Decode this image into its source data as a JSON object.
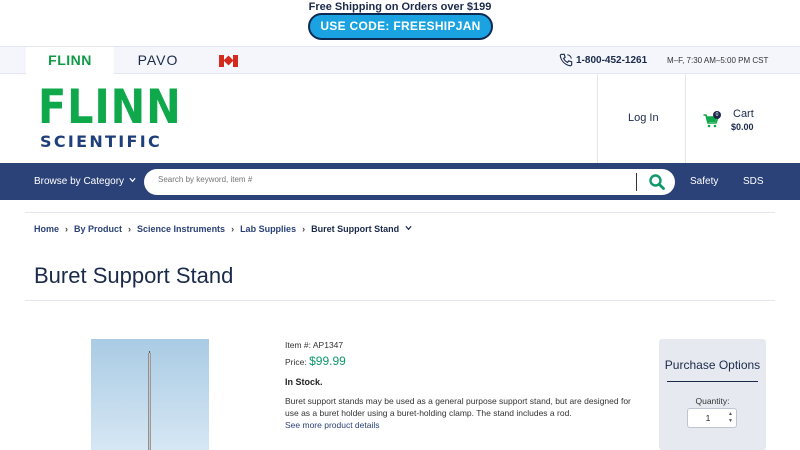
{
  "promo": {
    "text": "Free Shipping on Orders over $199",
    "code": "USE CODE: FREESHIPJAN"
  },
  "brand_tabs": {
    "flinn": "FLINN",
    "pavo": "PAVO",
    "canada_flag": "canada-flag-icon"
  },
  "contact": {
    "phone": "1-800-452-1261",
    "hours": "M–F, 7:30 AM–5:00 PM CST"
  },
  "logo": {
    "line1": "FLINN",
    "line2": "SCIENTIFIC"
  },
  "account": {
    "login": "Log In",
    "cart_label": "Cart",
    "cart_total": "$0.00",
    "cart_count": "0"
  },
  "nav": {
    "browse": "Browse by Category",
    "search_placeholder": "Search by keyword, item #",
    "safety": "Safety",
    "sds": "SDS"
  },
  "breadcrumb": {
    "items": [
      "Home",
      "By Product",
      "Science Instruments",
      "Lab Supplies"
    ],
    "current": "Buret Support Stand"
  },
  "product": {
    "title": "Buret Support Stand",
    "item_number": "Item #: AP1347",
    "price_label": "Price:",
    "price": "$99.99",
    "stock": "In Stock.",
    "description": "Buret support stands may be used as a general purpose support stand, but are designed for use as a buret holder using a buret-holding clamp. The stand includes a rod.",
    "more_link": "See more product details"
  },
  "purchase": {
    "title": "Purchase Options",
    "quantity_label": "Quantity:",
    "quantity": "1"
  },
  "colors": {
    "brand_green": "#0fa84a",
    "navy": "#2b4278",
    "promo_blue": "#1aa3e0",
    "price_green": "#0f9a6a"
  }
}
